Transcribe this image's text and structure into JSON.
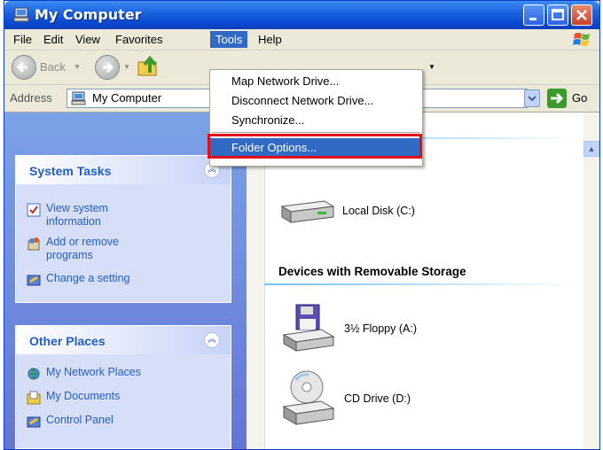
{
  "window": {
    "title": "My Computer"
  },
  "menubar": {
    "items": [
      "File",
      "Edit",
      "View",
      "Favorites",
      "Tools",
      "Help"
    ],
    "active": "Tools"
  },
  "toolbar": {
    "back_label": "Back"
  },
  "address": {
    "label": "Address",
    "value": "My Computer",
    "go_label": "Go"
  },
  "tools_menu": {
    "items": [
      "Map Network Drive...",
      "Disconnect Network Drive...",
      "Synchronize...",
      "Folder Options..."
    ],
    "selected": "Folder Options..."
  },
  "system_tasks": {
    "title": "System Tasks",
    "items": [
      {
        "label_line1": "View system",
        "label_line2": "information",
        "icon": "system-info-icon"
      },
      {
        "label_line1": "Add or remove",
        "label_line2": "programs",
        "icon": "add-remove-programs-icon"
      },
      {
        "label_line1": "Change a setting",
        "label_line2": "",
        "icon": "control-panel-icon"
      }
    ]
  },
  "other_places": {
    "title": "Other Places",
    "items": [
      {
        "label": "My Network Places",
        "icon": "network-places-icon"
      },
      {
        "label": "My Documents",
        "icon": "my-documents-icon"
      },
      {
        "label": "Control Panel",
        "icon": "control-panel-icon"
      }
    ]
  },
  "content": {
    "hard_disk": {
      "label": "Local Disk (C:)",
      "icon": "hard-disk-icon"
    },
    "removable_heading": "Devices with Removable Storage",
    "removable": [
      {
        "label": "3½ Floppy (A:)",
        "icon": "floppy-drive-icon"
      },
      {
        "label": "CD Drive (D:)",
        "icon": "cd-drive-icon"
      }
    ]
  },
  "colors": {
    "titlebar": "#0a4bd3",
    "menu_highlight": "#316ac5",
    "task_link": "#215dc6",
    "annotation_box": "#e20f1a"
  }
}
